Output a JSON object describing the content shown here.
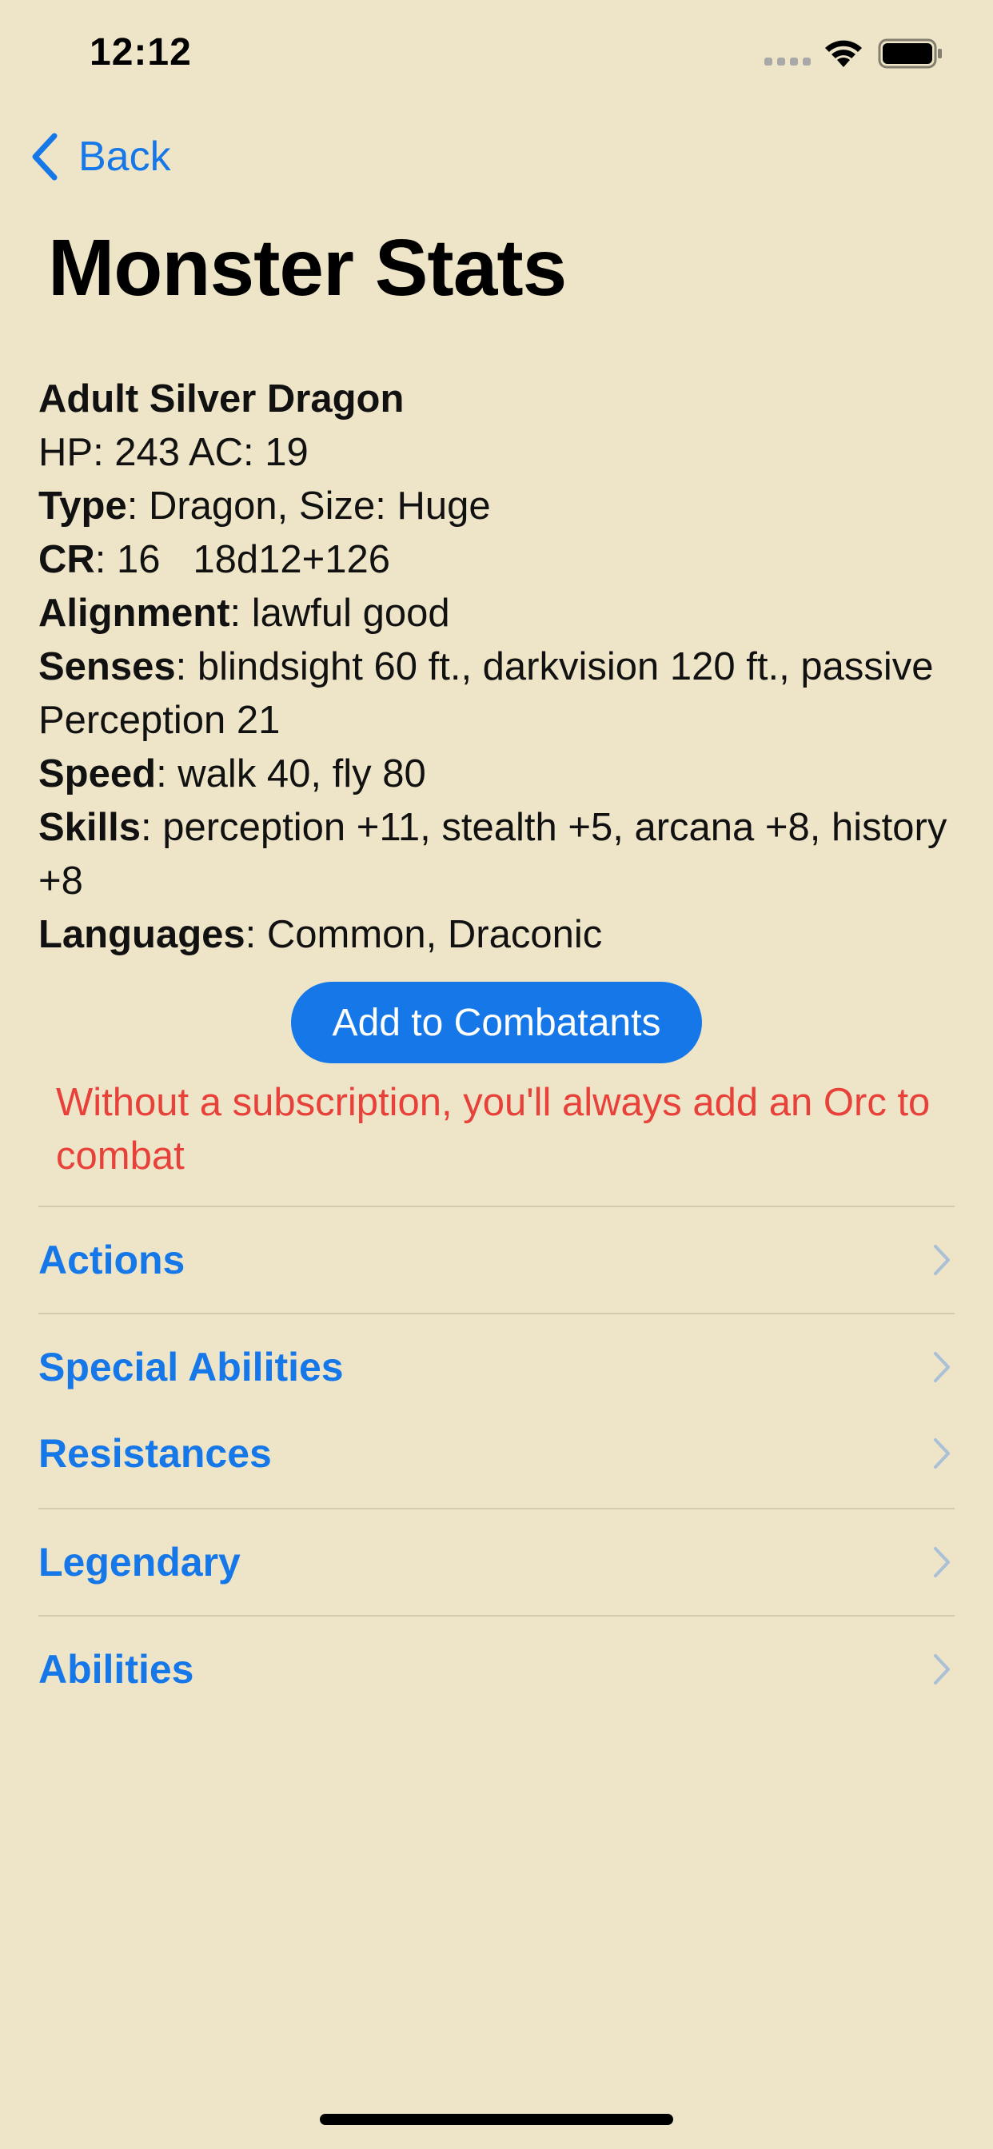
{
  "status_bar": {
    "time": "12:12"
  },
  "nav": {
    "back_label": "Back",
    "title": "Monster Stats"
  },
  "monster": {
    "name": "Adult Silver Dragon",
    "hp_ac": "HP: 243 AC: 19",
    "type_label": "Type",
    "type_value": ": Dragon, Size: Huge",
    "cr_label": "CR",
    "cr_value": ": 16   18d12+126",
    "alignment_label": "Alignment",
    "alignment_value": ": lawful good",
    "senses_label": "Senses",
    "senses_value": ": blindsight 60 ft., darkvision 120 ft., passive Perception 21",
    "speed_label": "Speed",
    "speed_value": ": walk 40, fly 80",
    "skills_label": "Skills",
    "skills_value": ": perception +11, stealth +5, arcana +8, history +8",
    "languages_label": "Languages",
    "languages_value": ": Common, Draconic"
  },
  "add_button_label": "Add to Combatants",
  "warning": "Without a subscription, you'll always add an Orc to combat",
  "sections": {
    "actions": "Actions",
    "special_abilities": "Special Abilities",
    "resistances": "Resistances",
    "legendary": "Legendary",
    "abilities": "Abilities"
  },
  "colors": {
    "background": "#EEE5C8",
    "accent": "#1677E8",
    "warning": "#E8413A"
  },
  "icons": [
    "back-chevron-icon",
    "wifi-icon",
    "battery-icon",
    "chevron-right-icon"
  ]
}
